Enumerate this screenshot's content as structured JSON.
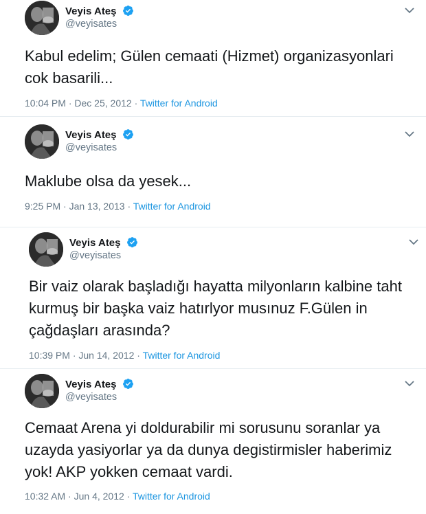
{
  "tweets": [
    {
      "name": "Veyis Ateş",
      "handle": "@veyisates",
      "lines": [
        "Kabul edelim; Gülen cemaati (Hizmet) organizasyonlari",
        "cok basarili..."
      ],
      "time": "10:04 PM",
      "date": "Dec 25, 2012",
      "source": "Twitter for Android"
    },
    {
      "name": "Veyis Ateş",
      "handle": "@veyisates",
      "lines": [
        "Maklube olsa da yesek..."
      ],
      "time": "9:25 PM",
      "date": "Jan 13, 2013",
      "source": "Twitter for Android"
    },
    {
      "name": "Veyis Ateş",
      "handle": "@veyisates",
      "lines": [
        "Bir vaiz olarak başladığı hayatta milyonların kalbine taht",
        "kurmuş bir başka vaiz hatırlyor musınuz F.Gülen in",
        "çağdaşları arasında?"
      ],
      "time": "10:39 PM",
      "date": "Jun 14, 2012",
      "source": "Twitter for Android"
    },
    {
      "name": "Veyis Ateş",
      "handle": "@veyisates",
      "lines": [
        "Cemaat Arena yi doldurabilir mi sorusunu soranlar ya",
        "uzayda yasiyorlar ya da  dunya degistirmisler haberimiz",
        "yok! AKP yokken cemaat vardi."
      ],
      "time": "10:32 AM",
      "date": "Jun 4, 2012",
      "source": "Twitter for Android"
    }
  ],
  "colors": {
    "text": "#14171a",
    "secondary": "#657786",
    "link": "#1b95e0",
    "verified": "#1da1f2",
    "divider": "#e6ecf0"
  },
  "icons": {
    "verified": "verified-badge-icon",
    "caret": "chevron-down-icon",
    "avatar": "profile-photo"
  },
  "meta_separator": "·"
}
